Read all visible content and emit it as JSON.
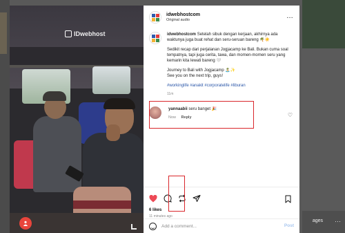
{
  "background": {
    "right_label": "ages",
    "right_menu": "⋯"
  },
  "media": {
    "watermark": "IDwebhost",
    "mute_icon": "person-icon",
    "volume_icon": "volume-icon"
  },
  "post": {
    "username": "idwebhostcom",
    "audio": "Original audio",
    "more_icon": "…",
    "caption": {
      "user": "idwebhostcom",
      "p1": "Setelah sibuk dengan kerjaan, akhirnya ada waktunya juga buat rehat dan seru-seruan bareng 🌴☀️",
      "p2": "Sedikit recap dari perjalanan Jogjacamp ke Bali. Bukan cuma soal tempatnya, tapi juga cerita, tawa, dan momen-momen seru yang kemarin kita lewati bareng 🤍",
      "p3a": "Journey to Bali with Jogjacamp 🏝️✨",
      "p3b": "See you on the next trip, guys!",
      "tags": "#workinglife #anakit #corporatelife #liburan",
      "time": "11m"
    },
    "comment": {
      "user": "yannaabii",
      "text": "seru banget 🎉",
      "time": "Now",
      "reply": "Reply",
      "like_icon": "♡"
    },
    "likes": "6 likes",
    "ago": "11 minutes ago",
    "add_comment_placeholder": "Add a comment...",
    "post_label": "Post"
  },
  "icons": {
    "heart": "heart-filled-icon",
    "comment": "comment-icon",
    "repost": "repost-icon",
    "share": "share-icon",
    "bookmark": "bookmark-icon",
    "emoji": "emoji-icon"
  },
  "colors": {
    "highlight": "#d9252a",
    "like": "#ed4956",
    "hashtag": "#2a56a8",
    "post_disabled": "#a9c7ef"
  }
}
